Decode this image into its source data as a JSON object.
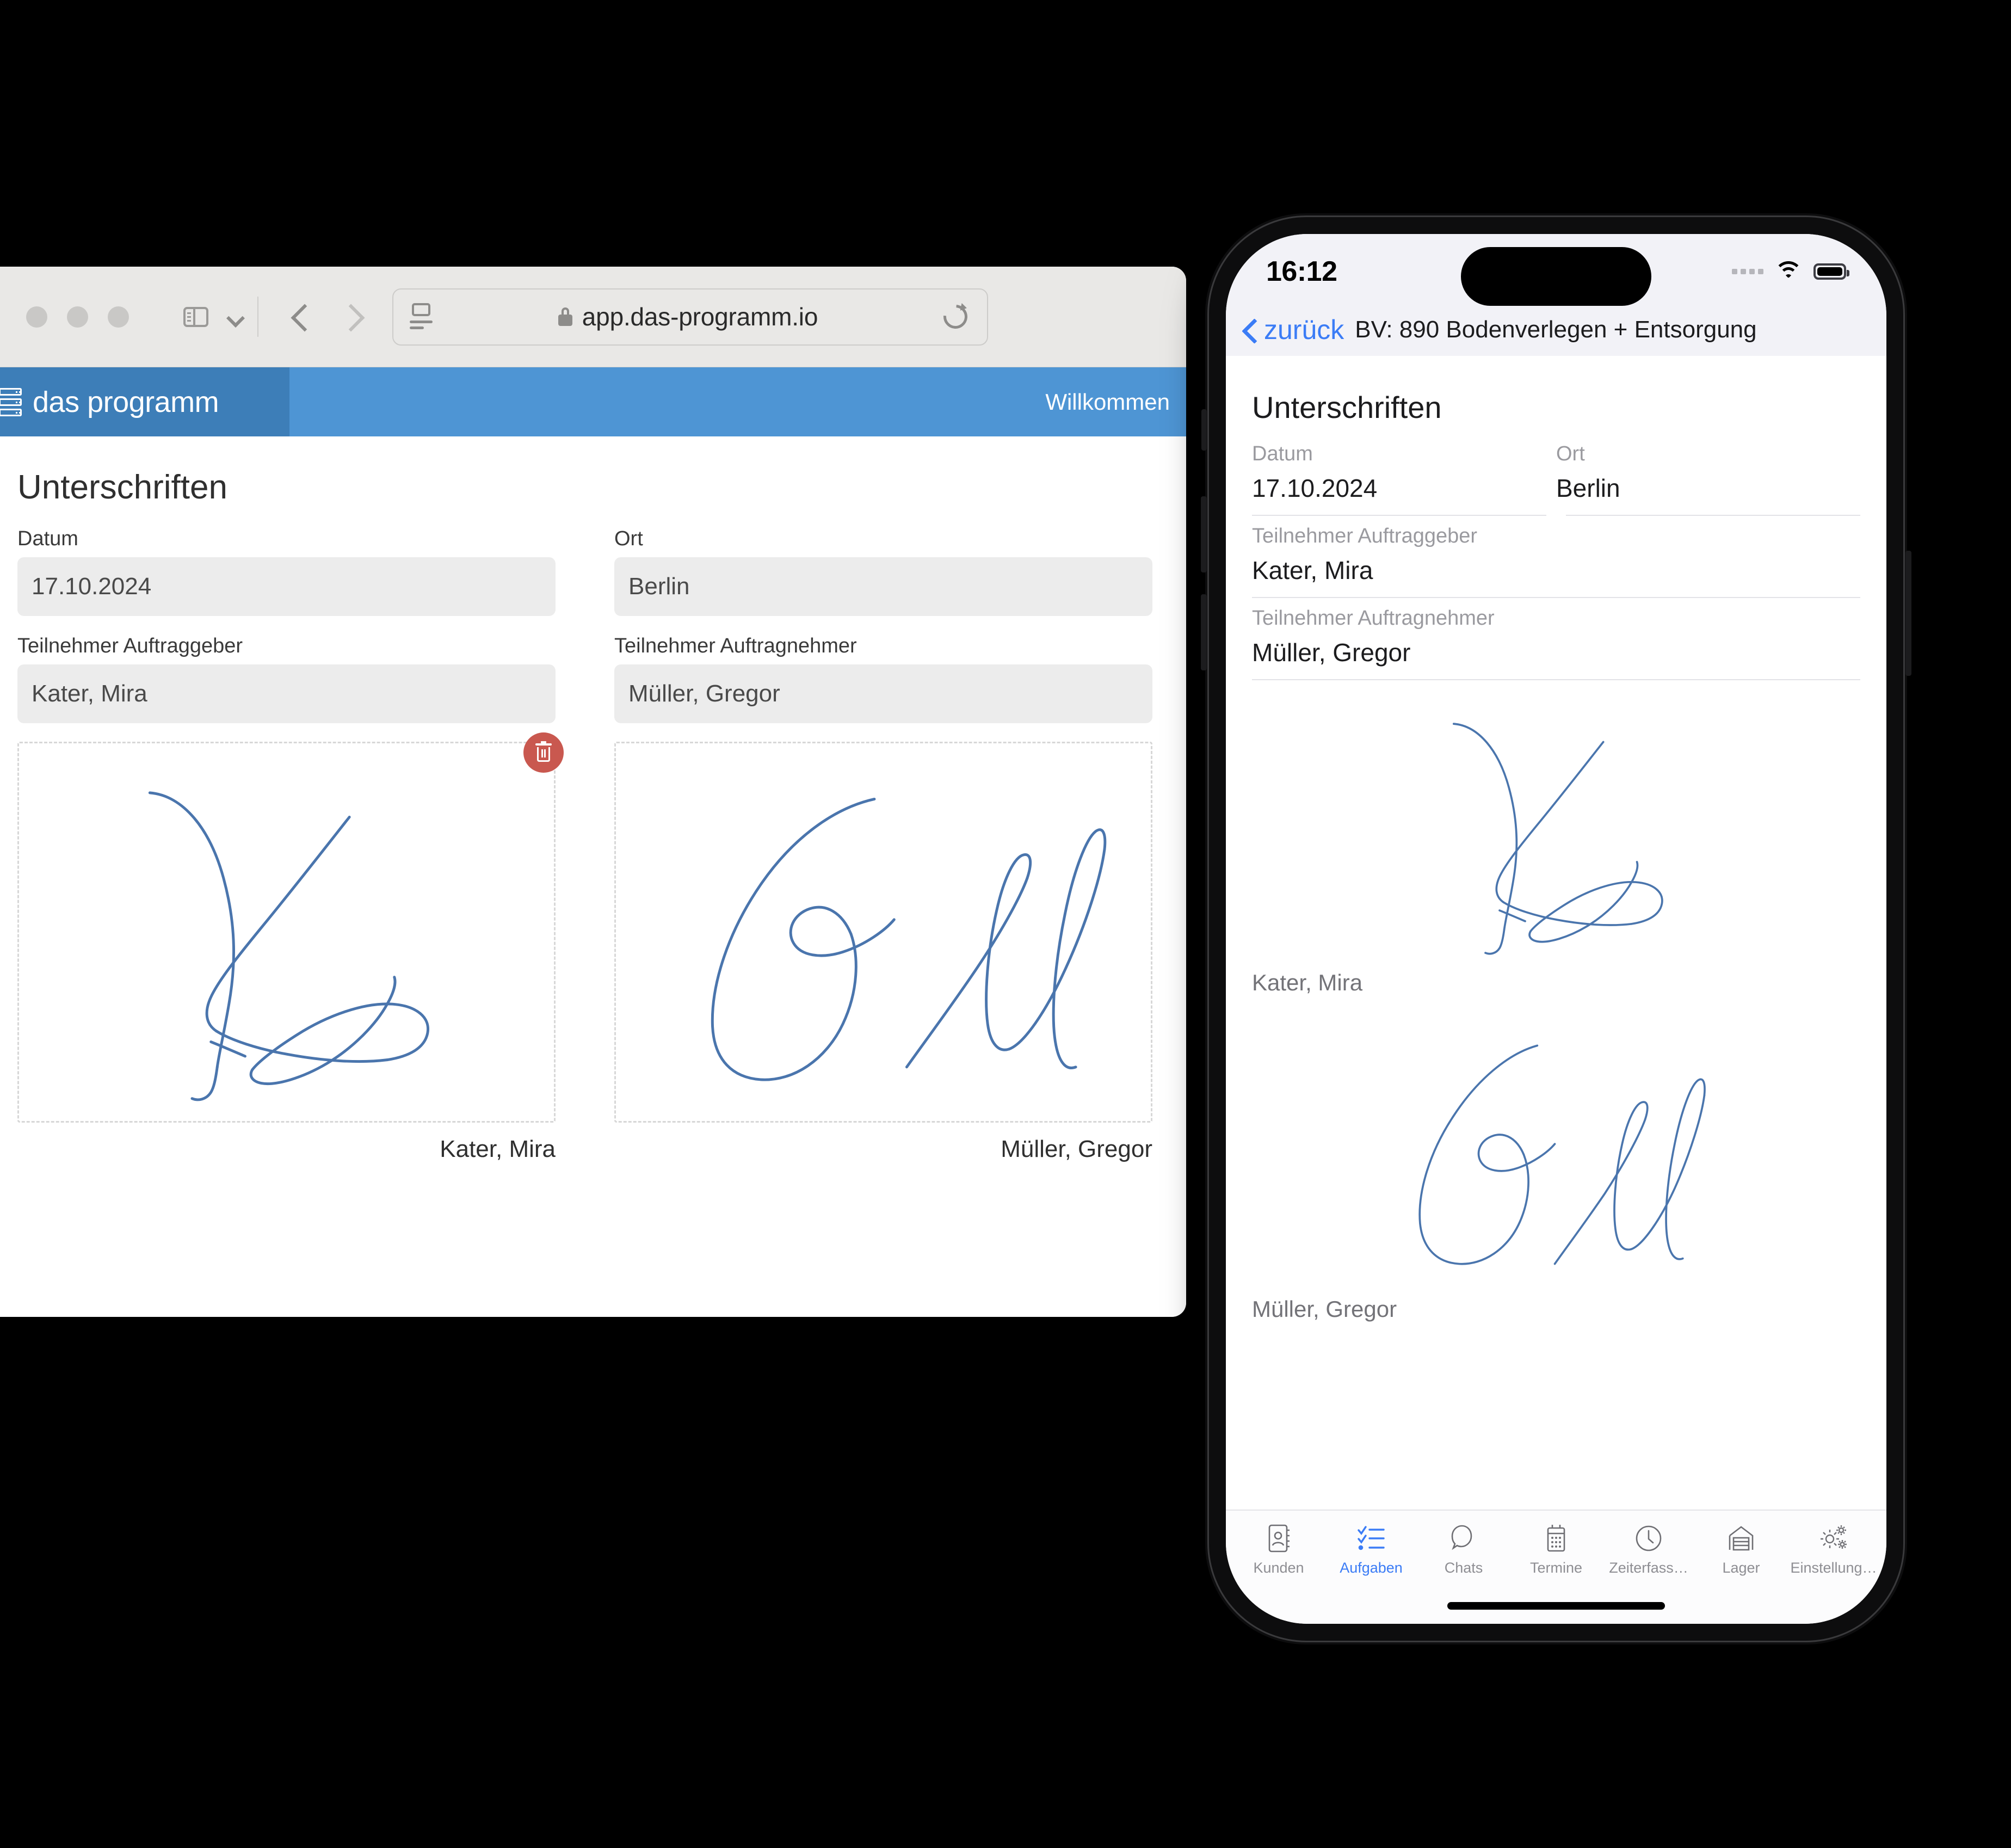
{
  "browser": {
    "url": "app.das-programm.io",
    "toolbar_icons": [
      "sidebar-toggle-icon",
      "chevron-down-icon",
      "back-icon",
      "forward-icon",
      "reader-icon",
      "lock-icon",
      "reload-icon"
    ],
    "app": {
      "brand": "das programm",
      "brand_icon": "server-stack-icon",
      "welcome": "Willkommen",
      "brand_bg": "#3d7eb8",
      "header_bg": "#4e95d4"
    },
    "page": {
      "title": "Unterschriften",
      "fields": [
        {
          "label": "Datum",
          "value": "17.10.2024"
        },
        {
          "label": "Ort",
          "value": "Berlin"
        },
        {
          "label": "Teilnehmer Auftraggeber",
          "value": "Kater, Mira"
        },
        {
          "label": "Teilnehmer Auftragnehmer",
          "value": "Müller, Gregor"
        }
      ],
      "signatures": [
        {
          "name": "Kater, Mira",
          "has_delete": true,
          "delete_icon": "trash-icon",
          "delete_color": "#c9584f"
        },
        {
          "name": "Müller, Gregor",
          "has_delete": false
        }
      ]
    }
  },
  "phone": {
    "status": {
      "time": "16:12",
      "signal_icon": "cellular-signal-icon",
      "wifi_icon": "wifi-icon",
      "battery_icon": "battery-icon"
    },
    "nav": {
      "back_icon": "chevron-left-icon",
      "back_label": "zurück",
      "title": "BV: 890 Bodenverlegen + Entsorgung",
      "accent": "#3b7cf6"
    },
    "content": {
      "title": "Unterschriften",
      "fields": [
        {
          "label": "Datum",
          "value": "17.10.2024"
        },
        {
          "label": "Ort",
          "value": "Berlin"
        },
        {
          "label": "Teilnehmer Auftraggeber",
          "value": "Kater, Mira"
        },
        {
          "label": "Teilnehmer Auftragnehmer",
          "value": "Müller, Gregor"
        }
      ],
      "signatures": [
        {
          "name": "Kater, Mira"
        },
        {
          "name": "Müller, Gregor"
        }
      ]
    },
    "tabs": [
      {
        "label": "Kunden",
        "icon": "contacts-book-icon",
        "active": false
      },
      {
        "label": "Aufgaben",
        "icon": "checklist-icon",
        "active": true
      },
      {
        "label": "Chats",
        "icon": "chat-bubble-icon",
        "active": false
      },
      {
        "label": "Termine",
        "icon": "calendar-icon",
        "active": false
      },
      {
        "label": "Zeiterfass…",
        "icon": "clock-icon",
        "active": false
      },
      {
        "label": "Lager",
        "icon": "warehouse-icon",
        "active": false
      },
      {
        "label": "Einstellung…",
        "icon": "gears-icon",
        "active": false
      }
    ]
  }
}
